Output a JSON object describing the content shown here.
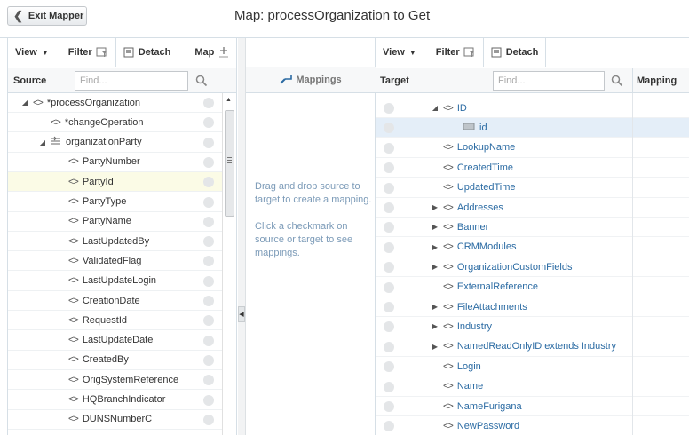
{
  "header": {
    "exit_label": "Exit Mapper",
    "title": "Map: processOrganization to Get"
  },
  "source_toolbar": {
    "view_label": "View",
    "filter_label": "Filter",
    "detach_label": "Detach",
    "map_label": "Map"
  },
  "source_header": {
    "label": "Source",
    "find_placeholder": "Find..."
  },
  "source_rows": [
    {
      "label": "*processOrganization",
      "expand": "◢",
      "icon": "<>"
    },
    {
      "label": "*changeOperation",
      "expand": "",
      "icon": "<>"
    },
    {
      "label": "organizationParty",
      "expand": "◢",
      "icon": "list"
    },
    {
      "label": "PartyNumber",
      "expand": "",
      "icon": "<>"
    },
    {
      "label": "PartyId",
      "expand": "",
      "icon": "<>",
      "selected": true
    },
    {
      "label": "PartyType",
      "expand": "",
      "icon": "<>"
    },
    {
      "label": "PartyName",
      "expand": "",
      "icon": "<>"
    },
    {
      "label": "LastUpdatedBy",
      "expand": "",
      "icon": "<>"
    },
    {
      "label": "ValidatedFlag",
      "expand": "",
      "icon": "<>"
    },
    {
      "label": "LastUpdateLogin",
      "expand": "",
      "icon": "<>"
    },
    {
      "label": "CreationDate",
      "expand": "",
      "icon": "<>"
    },
    {
      "label": "RequestId",
      "expand": "",
      "icon": "<>"
    },
    {
      "label": "LastUpdateDate",
      "expand": "",
      "icon": "<>"
    },
    {
      "label": "CreatedBy",
      "expand": "",
      "icon": "<>"
    },
    {
      "label": "OrigSystemReference",
      "expand": "",
      "icon": "<>"
    },
    {
      "label": "HQBranchIndicator",
      "expand": "",
      "icon": "<>"
    },
    {
      "label": "DUNSNumberC",
      "expand": "",
      "icon": "<>"
    }
  ],
  "mappings": {
    "title": "Mappings",
    "hint_1": "Drag and drop source to target to create a mapping.",
    "hint_2": "Click a checkmark on source or target to see mappings."
  },
  "target_toolbar": {
    "view_label": "View",
    "filter_label": "Filter",
    "detach_label": "Detach"
  },
  "target_header": {
    "label": "Target",
    "find_placeholder": "Find...",
    "mapping_label": "Mapping"
  },
  "target_rows": [
    {
      "label": "ID",
      "expand": "◢",
      "icon": "<>"
    },
    {
      "label": "id",
      "expand": "",
      "icon": "attr",
      "selected": true
    },
    {
      "label": "LookupName",
      "expand": "",
      "icon": "<>"
    },
    {
      "label": "CreatedTime",
      "expand": "",
      "icon": "<>"
    },
    {
      "label": "UpdatedTime",
      "expand": "",
      "icon": "<>"
    },
    {
      "label": "Addresses",
      "expand": "▶",
      "icon": "<>"
    },
    {
      "label": "Banner",
      "expand": "▶",
      "icon": "<>"
    },
    {
      "label": "CRMModules",
      "expand": "▶",
      "icon": "<>"
    },
    {
      "label": "OrganizationCustomFields",
      "expand": "▶",
      "icon": "<>"
    },
    {
      "label": "ExternalReference",
      "expand": "",
      "icon": "<>"
    },
    {
      "label": "FileAttachments",
      "expand": "▶",
      "icon": "<>"
    },
    {
      "label": "Industry",
      "expand": "▶",
      "icon": "<>"
    },
    {
      "label": "NamedReadOnlyID extends Industry",
      "expand": "▶",
      "icon": "<>"
    },
    {
      "label": "Login",
      "expand": "",
      "icon": "<>"
    },
    {
      "label": "Name",
      "expand": "",
      "icon": "<>"
    },
    {
      "label": "NameFurigana",
      "expand": "",
      "icon": "<>"
    },
    {
      "label": "NewPassword",
      "expand": "",
      "icon": "<>"
    }
  ],
  "colors": {
    "accent": "#2b6ba3",
    "selected_row": "#fbfbe6",
    "selected_target": "#e4eef8",
    "hint_text": "#7c9bb8"
  }
}
